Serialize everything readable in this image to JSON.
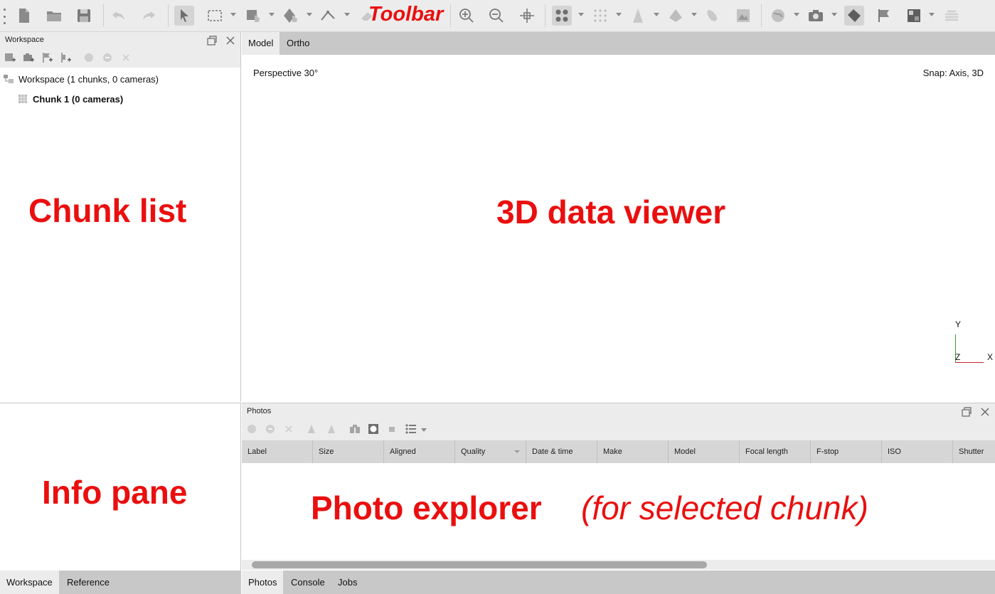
{
  "annotations": {
    "toolbar": "Toolbar",
    "chunk_list": "Chunk list",
    "viewer": "3D data viewer",
    "info_pane": "Info pane",
    "photo_explorer": "Photo explorer",
    "photo_explorer_note": "(for selected chunk)"
  },
  "toolbar": {
    "icons": [
      "new-document-icon",
      "open-folder-icon",
      "save-disk-icon",
      "undo-icon",
      "redo-icon",
      "navigation-pointer-icon",
      "rectangle-selection-icon",
      "transform-object-icon",
      "resize-region-icon",
      "ruler-icon",
      "eraser-icon",
      "zoom-in-icon",
      "zoom-out-icon",
      "reset-view-icon",
      "point-cloud-icon",
      "dense-cloud-icon",
      "mesh-icon",
      "model-shaded-icon",
      "tiled-model-icon",
      "dem-icon",
      "orthomosaic-icon",
      "camera-icon",
      "toggle-shapes-icon",
      "markers-icon",
      "texture-icon",
      "stack-icon"
    ]
  },
  "workspace_panel": {
    "title": "Workspace",
    "tree_root": "Workspace (1 chunks, 0 cameras)",
    "chunk": "Chunk 1 (0 cameras)"
  },
  "viewer": {
    "tabs": [
      "Model",
      "Ortho"
    ],
    "projection": "Perspective 30°",
    "snap": "Snap: Axis, 3D",
    "axes": {
      "y": "Y",
      "z": "Z",
      "x": "X"
    }
  },
  "photos_panel": {
    "title": "Photos",
    "columns": [
      "Label",
      "Size",
      "Aligned",
      "Quality",
      "Date & time",
      "Make",
      "Model",
      "Focal length",
      "F-stop",
      "ISO",
      "Shutter"
    ]
  },
  "bottom_left_tabs": [
    "Workspace",
    "Reference"
  ],
  "bottom_right_tabs": [
    "Photos",
    "Console",
    "Jobs"
  ],
  "colors": {
    "annotation_red": "#ea0f0f",
    "panel_bg": "#ececec",
    "tab_bar_bg": "#c8c8c8",
    "axis_y": "#2a9d2a",
    "axis_x": "#c0272d"
  }
}
